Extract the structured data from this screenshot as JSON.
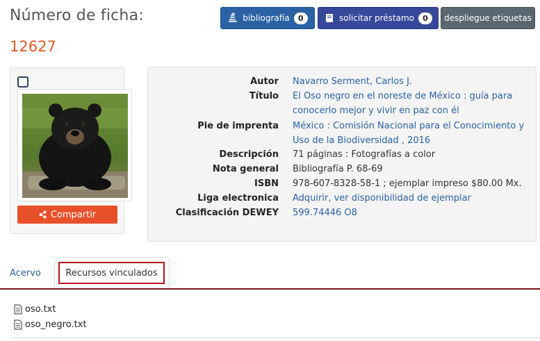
{
  "header": {
    "ficha_label": "Número de ficha:",
    "ficha_number": "12627"
  },
  "toolbar": {
    "bibliografia_label": "bibliografía",
    "bibliografia_count": "0",
    "prestamo_label": "solicitar préstamo",
    "prestamo_count": "0",
    "etiquetas_label": "despliegue etiquetas"
  },
  "record": {
    "share_label": "Compartir",
    "image_subject": "black bear photo",
    "fields": [
      {
        "label": "Autor",
        "value": "Navarro Serment, Carlos J.",
        "link": true
      },
      {
        "label": "Título",
        "value": "El Oso negro en el noreste de México : guía para conocerlo mejor y vivir en paz con él",
        "link": true
      },
      {
        "label": "Pie de imprenta",
        "value": "México : Comisión Nacional para el Conocimiento y Uso de la Biodiversidad , 2016",
        "link": true
      },
      {
        "label": "Descripción",
        "value": "71 páginas : Fotografías a color",
        "link": false
      },
      {
        "label": "Nota general",
        "value": "Bibliografía P. 68-69",
        "link": false
      },
      {
        "label": "ISBN",
        "value": "978-607-8328-58-1 ; ejemplar impreso $80.00 Mx.",
        "link": false
      },
      {
        "label": "Liga electronica",
        "value": "Adquirir, ver disponibilidad de ejemplar",
        "link": true
      },
      {
        "label": "Clasificación DEWEY",
        "value": "599.74446 O8",
        "link": true
      }
    ]
  },
  "tabs": {
    "acervo": "Acervo",
    "recursos": "Recursos vinculados"
  },
  "files": [
    "oso.txt",
    "oso_negro.txt"
  ],
  "colors": {
    "accent_orange": "#e05a25",
    "link_blue": "#2a62a4",
    "tab_border_red": "#b5121b"
  }
}
